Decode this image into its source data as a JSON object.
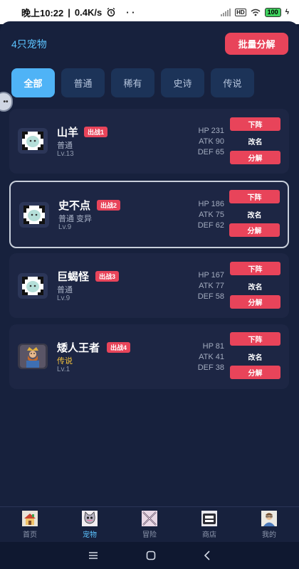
{
  "status_bar": {
    "time": "晚上10:22",
    "speed": "0.4K/s",
    "dots": "· ·",
    "battery": "100"
  },
  "header": {
    "pet_count": "4只宠物",
    "batch_button": "批量分解"
  },
  "tabs": [
    {
      "label": "全部",
      "active": true
    },
    {
      "label": "普通",
      "active": false
    },
    {
      "label": "稀有",
      "active": false
    },
    {
      "label": "史诗",
      "active": false
    },
    {
      "label": "传说",
      "active": false
    }
  ],
  "pets": [
    {
      "name": "山羊",
      "badge": "出战1",
      "rarity": "普通",
      "level": "Lv.13",
      "hp": "HP 231",
      "atk": "ATK 90",
      "def": "DEF 65",
      "icon": "ghost-pet-icon"
    },
    {
      "name": "史不点",
      "badge": "出战2",
      "rarity": "普通 变异",
      "level": "Lv.9",
      "hp": "HP 186",
      "atk": "ATK 75",
      "def": "DEF 62",
      "icon": "ghost-pet-icon"
    },
    {
      "name": "巨蝎怪",
      "badge": "出战3",
      "rarity": "普通",
      "level": "Lv.9",
      "hp": "HP 167",
      "atk": "ATK 77",
      "def": "DEF 58",
      "icon": "ghost-pet-icon"
    },
    {
      "name": "矮人王者",
      "badge": "出战4",
      "rarity": "传说",
      "level": "Lv.1",
      "hp": "HP 81",
      "atk": "ATK 41",
      "def": "DEF 38",
      "icon": "dwarf-king-icon"
    }
  ],
  "actions": {
    "unassign": "下阵",
    "rename": "改名",
    "decompose": "分解"
  },
  "bottom_nav": [
    {
      "label": "首页",
      "icon": "home-icon",
      "active": false
    },
    {
      "label": "宠物",
      "icon": "pet-cat-icon",
      "active": true
    },
    {
      "label": "冒险",
      "icon": "adventure-icon",
      "active": false
    },
    {
      "label": "商店",
      "icon": "shop-icon",
      "active": false
    },
    {
      "label": "我的",
      "icon": "profile-icon",
      "active": false
    }
  ],
  "colors": {
    "background": "#101a33",
    "accent_blue": "#4fb3f6",
    "accent_red": "#e8445a",
    "legend_gold": "#f4c23c"
  }
}
